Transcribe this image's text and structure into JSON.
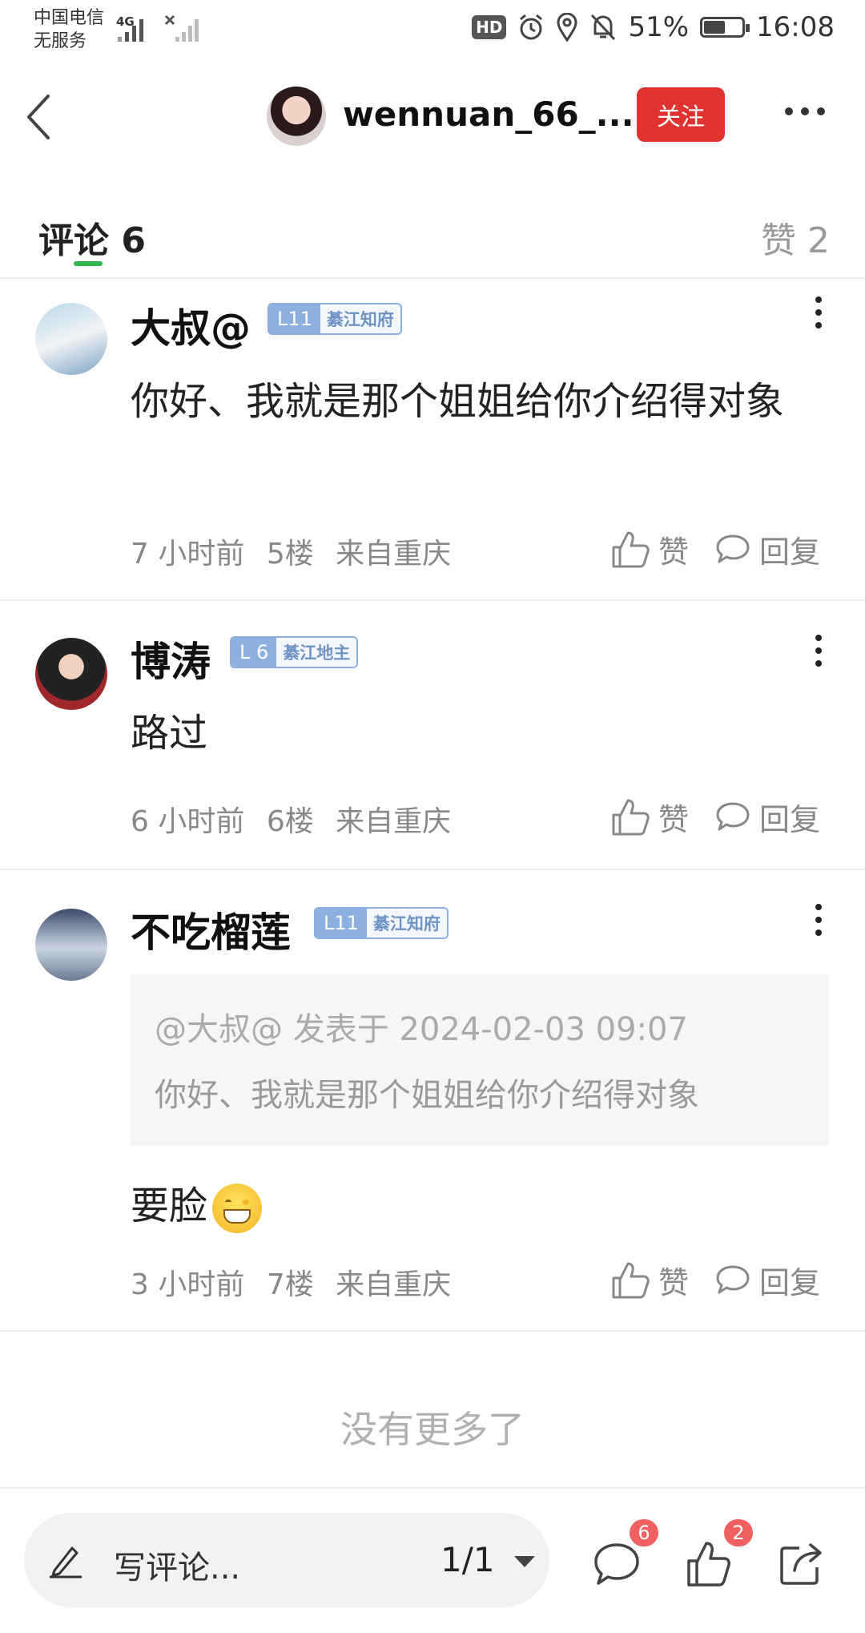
{
  "status_bar": {
    "carrier": "中国电信",
    "service": "无服务",
    "network": "4G",
    "hd": "HD",
    "battery": "51%",
    "battery_level": 0.51,
    "time": "16:08"
  },
  "header": {
    "title": "wennuan_66_...",
    "follow_label": "关注"
  },
  "tabs": {
    "comments_label": "评论 6",
    "likes_label": "赞 2"
  },
  "comments": [
    {
      "user": "大叔@",
      "level": "L11",
      "title": "綦江知府",
      "text": "你好、我就是那个姐姐给你介绍得对象",
      "time": "7 小时前",
      "floor": "5楼",
      "location": "来自重庆",
      "like_label": "赞",
      "reply_label": "回复"
    },
    {
      "user": "博涛",
      "level": "L 6",
      "title": "綦江地主",
      "text": "路过",
      "time": "6 小时前",
      "floor": "6楼",
      "location": "来自重庆",
      "like_label": "赞",
      "reply_label": "回复"
    },
    {
      "user": "不吃榴莲",
      "level": "L11",
      "title": "綦江知府",
      "quote_header": "@大叔@ 发表于 2024-02-03 09:07",
      "quote_text": "你好、我就是那个姐姐给你介绍得对象",
      "text": "要脸",
      "time": "3 小时前",
      "floor": "7楼",
      "location": "来自重庆",
      "like_label": "赞",
      "reply_label": "回复"
    }
  ],
  "no_more": "没有更多了",
  "bottom_bar": {
    "write_placeholder": "写评论...",
    "page": "1/1",
    "comment_count": "6",
    "like_count": "2"
  }
}
